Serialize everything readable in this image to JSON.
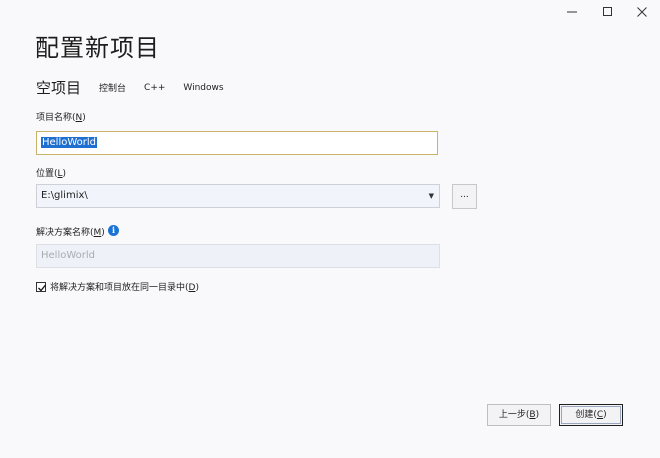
{
  "window": {
    "controls": {
      "minimize_icon": "minimize-icon",
      "maximize_icon": "maximize-icon",
      "close_icon": "close-icon"
    }
  },
  "header": {
    "title": "配置新项目",
    "template_name": "空项目",
    "tags": [
      "控制台",
      "C++",
      "Windows"
    ]
  },
  "form": {
    "project_name": {
      "label_prefix": "项目名称(",
      "label_key": "N",
      "label_suffix": ")",
      "value": "HelloWorld"
    },
    "location": {
      "label_prefix": "位置(",
      "label_key": "L",
      "label_suffix": ")",
      "value": "E:\\glimix\\",
      "dropdown_icon": "dropdown-arrow-icon",
      "browse_label": "..."
    },
    "solution_name": {
      "label_prefix": "解决方案名称(",
      "label_key": "M",
      "label_suffix": ")",
      "placeholder": "HelloWorld",
      "info_icon": "info-icon"
    },
    "same_directory": {
      "checked": true,
      "label_prefix": "将解决方案和项目放在同一目录中(",
      "label_key": "D",
      "label_suffix": ")"
    }
  },
  "footer": {
    "back_prefix": "上一步(",
    "back_key": "B",
    "back_suffix": ")",
    "create_prefix": "创建(",
    "create_key": "C",
    "create_suffix": ")"
  },
  "colors": {
    "accent": "#1f6fd1",
    "info": "#1a73d4",
    "focus_border": "#c9b26a"
  }
}
